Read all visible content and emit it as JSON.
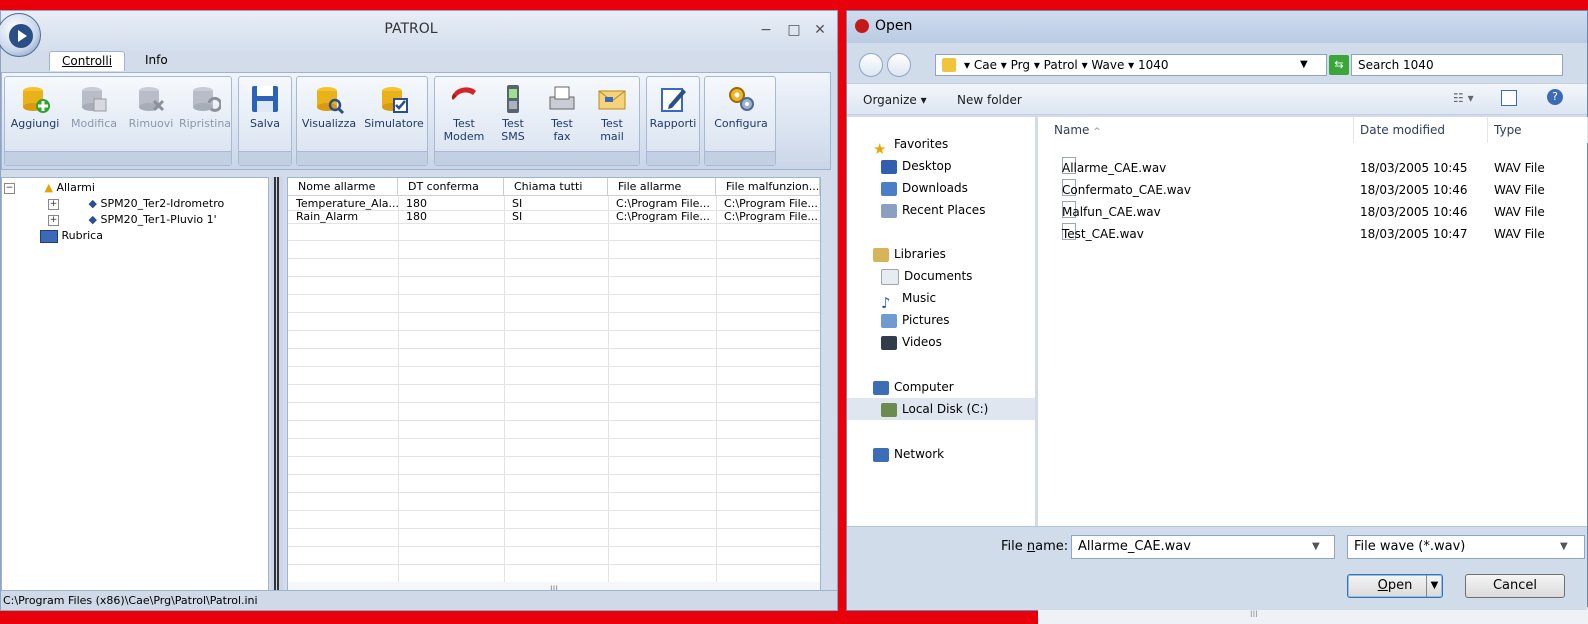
{
  "patrol": {
    "title": "PATROL",
    "controls": {
      "minimize": "−",
      "maximize": "□",
      "close": "✕"
    },
    "tabs": [
      {
        "label": "Controlli"
      },
      {
        "label": "Info"
      }
    ],
    "ribbon": {
      "buttons": [
        {
          "label": "Aggiungi",
          "enabled": true,
          "icon": "database-add-icon"
        },
        {
          "label": "Modifica",
          "enabled": false,
          "icon": "database-edit-icon"
        },
        {
          "label": "Rimuovi",
          "enabled": false,
          "icon": "database-remove-icon"
        },
        {
          "label": "Ripristina",
          "enabled": false,
          "icon": "database-restore-icon"
        },
        {
          "label": "Salva",
          "enabled": true,
          "icon": "save-floppy-icon"
        },
        {
          "label": "Visualizza",
          "enabled": true,
          "icon": "database-view-icon"
        },
        {
          "label": "Simulatore",
          "enabled": true,
          "icon": "database-simulate-icon"
        },
        {
          "label": "Test\nModem",
          "enabled": true,
          "icon": "phone-handset-icon"
        },
        {
          "label": "Test\nSMS",
          "enabled": true,
          "icon": "mobile-phone-icon"
        },
        {
          "label": "Test\nfax",
          "enabled": true,
          "icon": "fax-icon"
        },
        {
          "label": "Test\nmail",
          "enabled": true,
          "icon": "envelope-icon"
        },
        {
          "label": "Rapporti",
          "enabled": true,
          "icon": "report-pen-icon"
        },
        {
          "label": "Configura",
          "enabled": true,
          "icon": "gears-icon"
        }
      ]
    },
    "tree": {
      "root": "Allarmi",
      "children": [
        "SPM20_Ter2-Idrometro",
        "SPM20_Ter1-Pluvio 1'"
      ],
      "rubrica": "Rubrica"
    },
    "table": {
      "columns": [
        "Nome allarme",
        "DT conferma",
        "Chiama tutti",
        "File allarme",
        "File malfunzion..."
      ],
      "rows": [
        [
          "Temperature_Ala...",
          "180",
          "SI",
          "C:\\Program File...",
          "C:\\Program File..."
        ],
        [
          "Rain_Alarm",
          "180",
          "SI",
          "C:\\Program File...",
          "C:\\Program File..."
        ]
      ],
      "scroll_marker": "III"
    },
    "status": "C:\\Program Files (x86)\\Cae\\Prg\\Patrol\\Patrol.ini"
  },
  "dialog": {
    "title": "Open",
    "breadcrumb": [
      "Cae",
      "Prg",
      "Patrol",
      "Wave",
      "1040"
    ],
    "search_placeholder": "Search 1040",
    "toolbar": {
      "organize": "Organize ▾",
      "new_folder": "New folder"
    },
    "nav": {
      "favorites": "Favorites",
      "favorites_items": [
        "Desktop",
        "Downloads",
        "Recent Places"
      ],
      "libraries": "Libraries",
      "libraries_items": [
        "Documents",
        "Music",
        "Pictures",
        "Videos"
      ],
      "computer": "Computer",
      "computer_items": [
        "Local Disk (C:)"
      ],
      "network": "Network"
    },
    "columns": {
      "name": "Name",
      "date": "Date modified",
      "type": "Type"
    },
    "files": [
      {
        "name": "Allarme_CAE.wav",
        "date": "18/03/2005 10:45",
        "type": "WAV File"
      },
      {
        "name": "Confermato_CAE.wav",
        "date": "18/03/2005 10:46",
        "type": "WAV File"
      },
      {
        "name": "Malfun_CAE.wav",
        "date": "18/03/2005 10:46",
        "type": "WAV File"
      },
      {
        "name": "Test_CAE.wav",
        "date": "18/03/2005 10:47",
        "type": "WAV File"
      }
    ],
    "scroll_marker": "III",
    "file_name_label_pre": "File ",
    "file_name_label_u": "n",
    "file_name_label_post": "ame:",
    "file_name_value": "Allarme_CAE.wav",
    "filter": "File wave (*.wav)",
    "open_u": "O",
    "open_rest": "pen",
    "cancel": "Cancel"
  },
  "colors": {
    "desktop": "#e8000b",
    "ribbon_text": "#1e3a6b",
    "accent": "#3b6bb8"
  }
}
